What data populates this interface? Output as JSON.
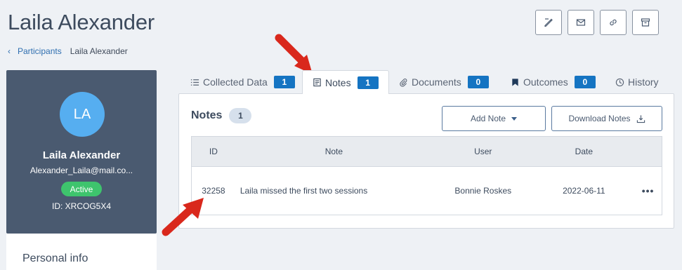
{
  "page": {
    "title": "Laila Alexander"
  },
  "breadcrumb": {
    "parent": "Participants",
    "current": "Laila Alexander"
  },
  "top_actions": [
    "edit-icon",
    "mail-icon",
    "link-icon",
    "archive-icon"
  ],
  "profile": {
    "initials": "LA",
    "name": "Laila Alexander",
    "email": "Alexander_Laila@mail.co...",
    "status": "Active",
    "id_text": "ID: XRCOG5X4"
  },
  "personal_info": {
    "title": "Personal info"
  },
  "tabs": [
    {
      "label": "Collected Data",
      "count": "1",
      "icon": "list-icon"
    },
    {
      "label": "Notes",
      "count": "1",
      "icon": "notes-icon",
      "active": true
    },
    {
      "label": "Documents",
      "count": "0",
      "icon": "paperclip-icon"
    },
    {
      "label": "Outcomes",
      "count": "0",
      "icon": "bookmark-icon"
    },
    {
      "label": "History",
      "icon": "clock-icon"
    }
  ],
  "notes_panel": {
    "title": "Notes",
    "count": "1",
    "add_note_label": "Add Note",
    "download_label": "Download Notes",
    "columns": [
      "ID",
      "Note",
      "User",
      "Date"
    ],
    "rows": [
      {
        "id": "32258",
        "note": "Laila missed the first two sessions",
        "user": "Bonnie Roskes",
        "date": "2022-06-11",
        "more": "•••"
      }
    ]
  },
  "colors": {
    "accent": "#1574c2",
    "sidebar": "#4a5a70",
    "avatar": "#56aef0",
    "status": "#3ec46d",
    "annotation_arrow": "#d9281c"
  }
}
